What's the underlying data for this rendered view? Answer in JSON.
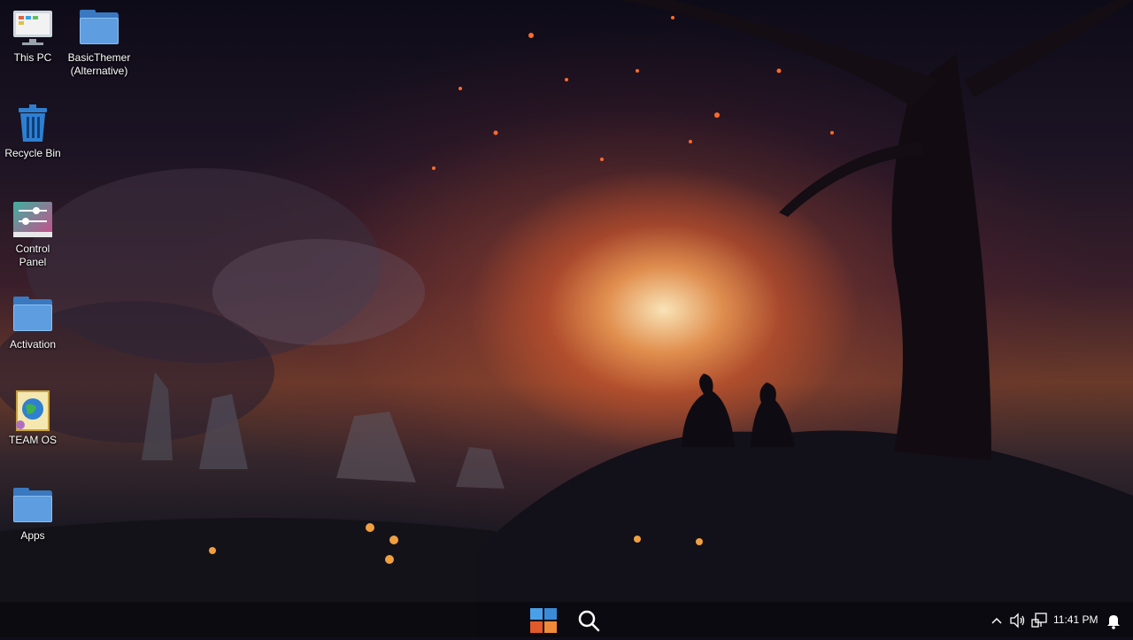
{
  "desktop": {
    "icons": [
      {
        "label": "This PC",
        "icon": "computer-icon"
      },
      {
        "label": "BasicThemer (Alternative)",
        "icon": "folder-icon"
      },
      {
        "label": "Recycle Bin",
        "icon": "recycle-bin-icon"
      },
      {
        "label": "Control Panel",
        "icon": "control-panel-icon"
      },
      {
        "label": "Activation",
        "icon": "folder-icon"
      },
      {
        "label": "TEAM OS",
        "icon": "team-os-icon"
      },
      {
        "label": "Apps",
        "icon": "folder-icon"
      }
    ]
  },
  "taskbar": {
    "start_icon": "windows-logo-icon",
    "search_icon": "search-icon",
    "tray": {
      "overflow_icon": "chevron-up-icon",
      "volume_icon": "speaker-icon",
      "network_icon": "network-icon",
      "notification_icon": "bell-icon"
    },
    "clock": "11:41 PM"
  },
  "colors": {
    "folder": "#5d9de0",
    "recycle_bin": "#2f7fd0",
    "windows_logo_accent": "#e05a2a"
  }
}
